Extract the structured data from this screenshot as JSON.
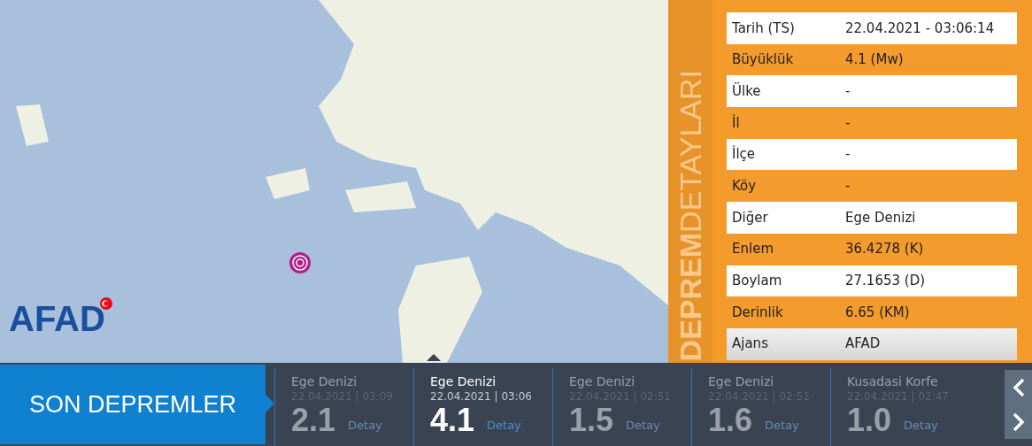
{
  "map": {
    "logo": "AFAD"
  },
  "details": {
    "title": "**DEPREM**DETAYLARI",
    "rows": [
      {
        "label": "Tarih (TS)",
        "value": "22.04.2021 - 03:06:14",
        "highlighted": false
      },
      {
        "label": "Büyüklük",
        "value": "4.1 (Mw)",
        "highlighted": false
      },
      {
        "label": "Ülke",
        "value": "-",
        "highlighted": false
      },
      {
        "label": "İl",
        "value": "-",
        "highlighted": false
      },
      {
        "label": "İlçe",
        "value": "-",
        "highlighted": false
      },
      {
        "label": "Köy",
        "value": "-",
        "highlighted": false
      },
      {
        "label": "Diğer",
        "value": "Ege Denizi",
        "highlighted": false
      },
      {
        "label": "Enlem",
        "value": "36.4278 (K)",
        "highlighted": false
      },
      {
        "label": "Boylam",
        "value": "27.1653 (D)",
        "highlighted": false
      },
      {
        "label": "Derinlik",
        "value": "6.65 (KM)",
        "highlighted": false
      },
      {
        "label": "Ajans",
        "value": "AFAD",
        "highlighted": true
      }
    ]
  },
  "recent": {
    "title": "SON DEPREMLER",
    "items": [
      {
        "place": "Ege Denizi",
        "time": "22.04.2021 | 03:09",
        "magnitude": "2.1",
        "link": "Detay",
        "selected": false
      },
      {
        "place": "Ege Denizi",
        "time": "22.04.2021 | 03:06",
        "magnitude": "4.1",
        "link": "Detay",
        "selected": true
      },
      {
        "place": "Ege Denizi",
        "time": "22.04.2021 | 02:51",
        "magnitude": "1.5",
        "link": "Detay",
        "selected": false
      },
      {
        "place": "Ege Denizi",
        "time": "22.04.2021 | 02:51",
        "magnitude": "1.6",
        "link": "Detay",
        "selected": false
      },
      {
        "place": "Kusadasi Korfe",
        "time": "22.04.2021 | 02:47",
        "magnitude": "1.0",
        "link": "Detay",
        "selected": false
      }
    ]
  }
}
